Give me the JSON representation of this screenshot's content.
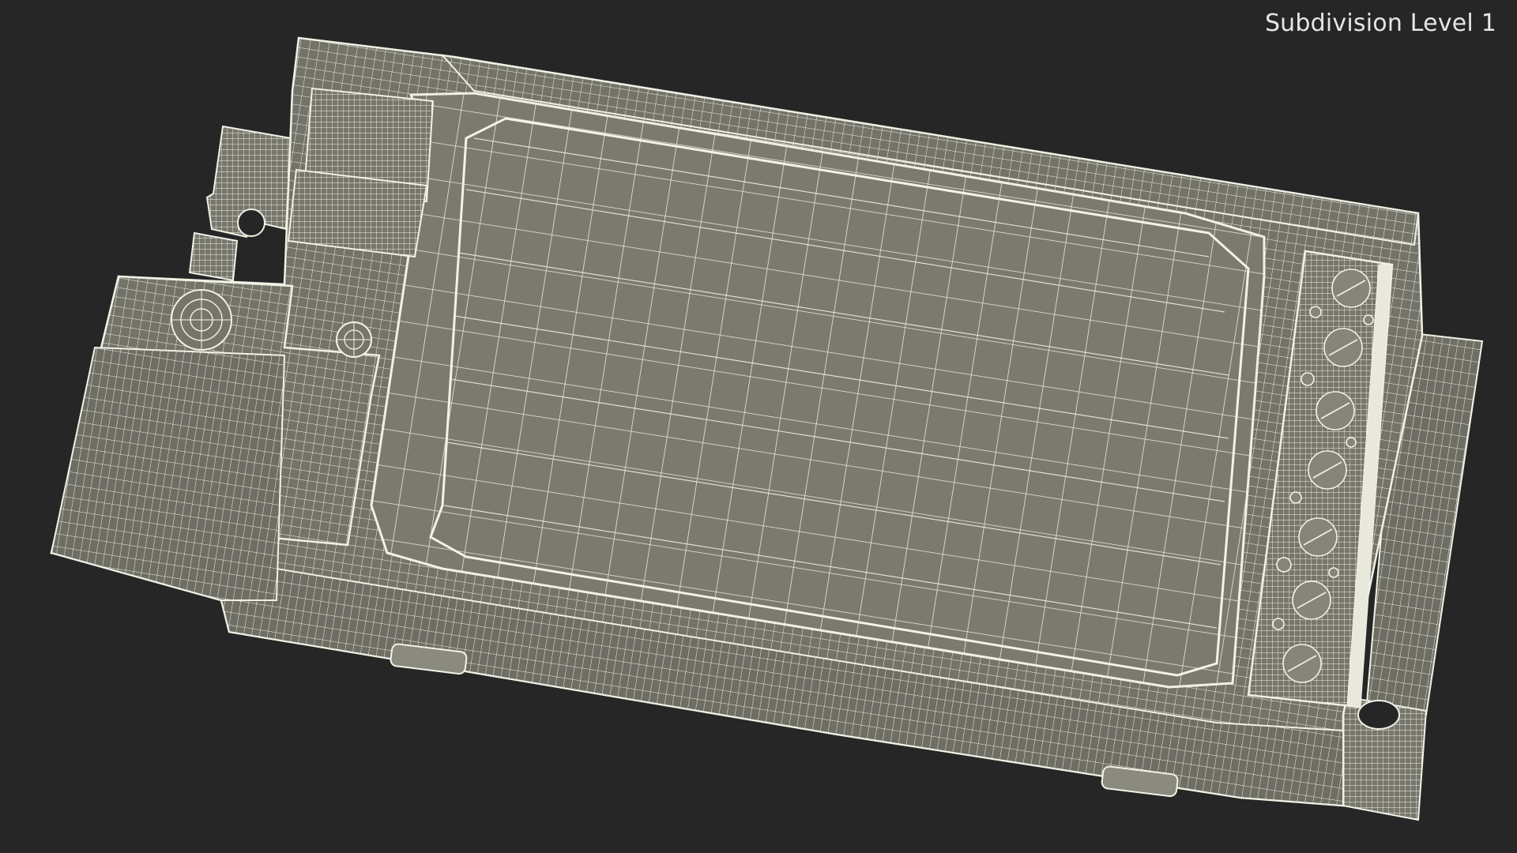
{
  "viewport": {
    "label": "Subdivision Level 1",
    "background": "#262626"
  },
  "model": {
    "description_colors": {
      "surface": "#7b7b71",
      "surface_dark": "#6a6a61",
      "wire": "#ecece0",
      "wire_dense": "#f4f4ea"
    }
  }
}
